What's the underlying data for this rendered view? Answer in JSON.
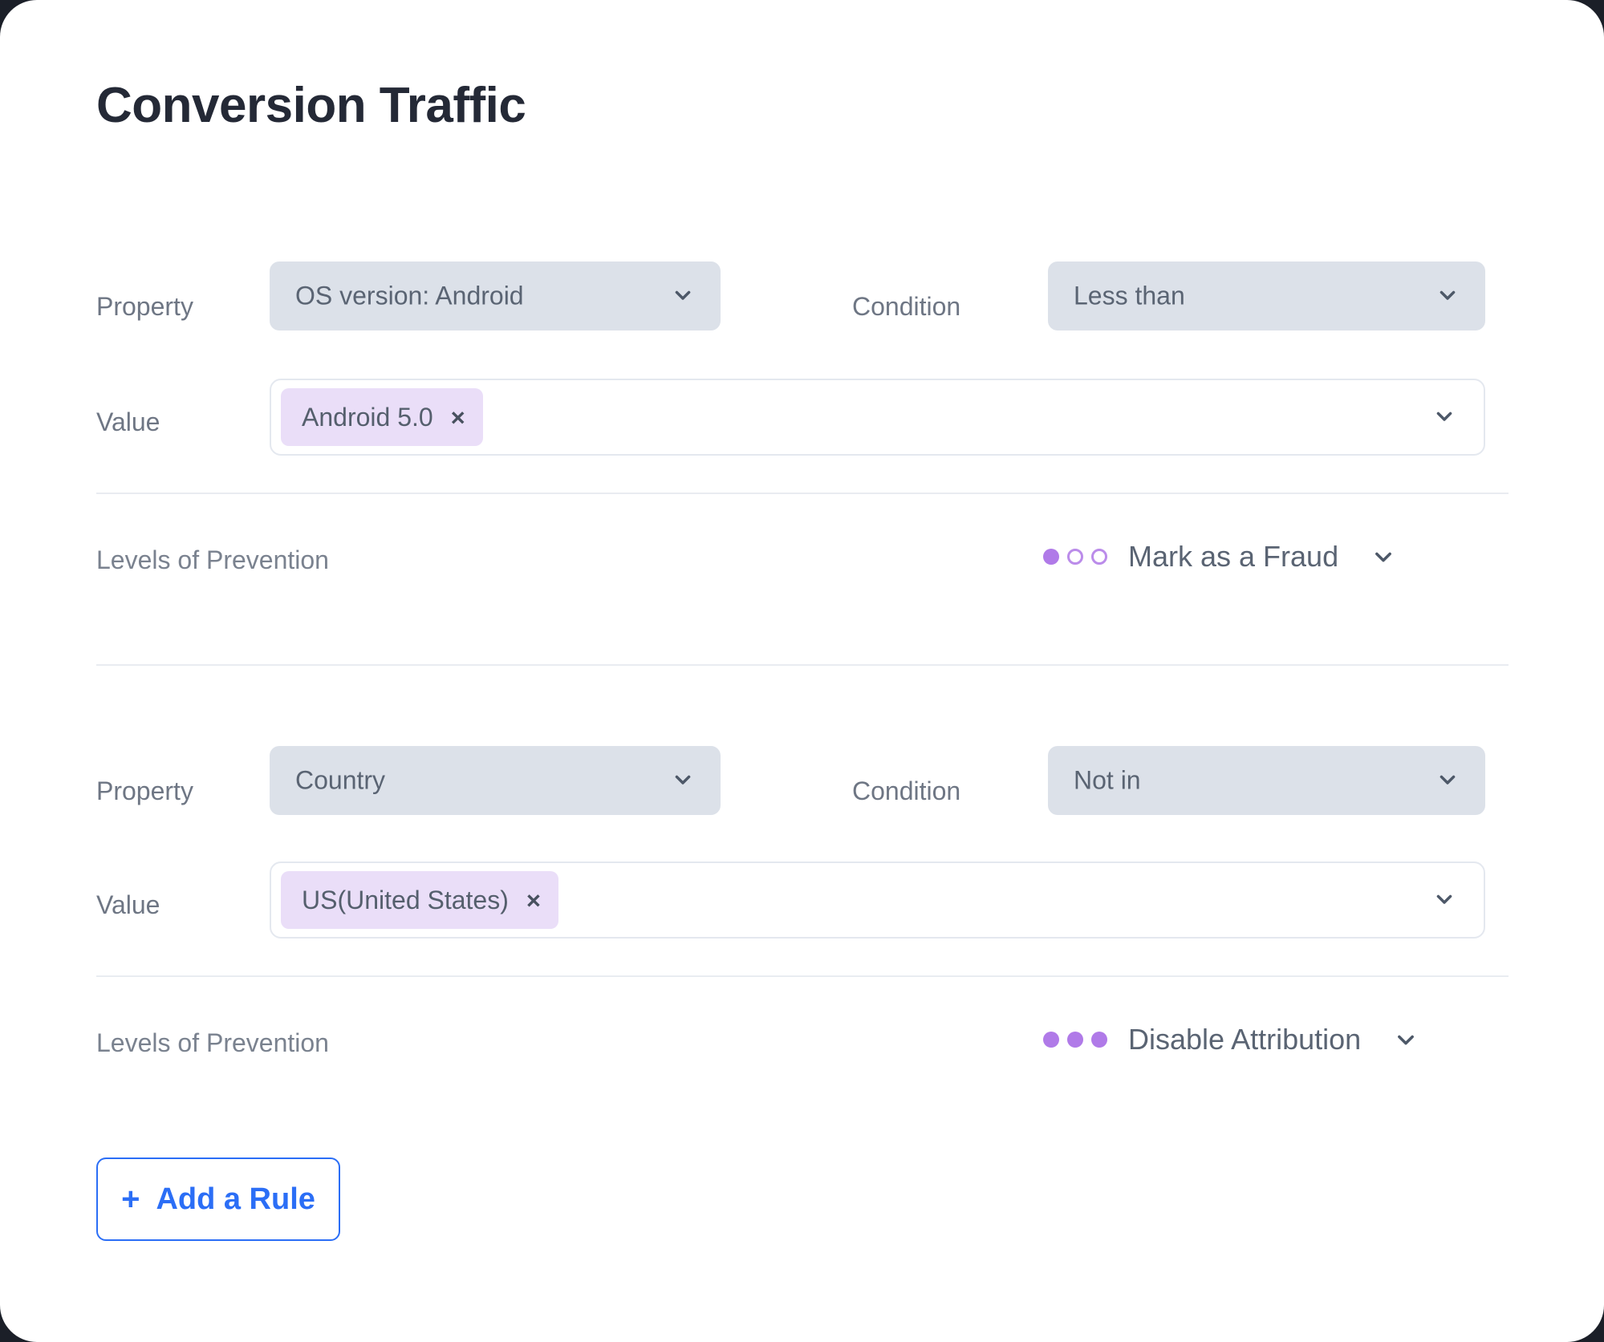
{
  "header": {
    "title": "Conversion Traffic"
  },
  "colors": {
    "accent_blue": "#2b6ef6",
    "chip_bg": "#eadef8",
    "select_bg": "#dce1e9",
    "dot_purple": "#b07ae8",
    "title_text": "#242936",
    "label_text": "#6e7684"
  },
  "labels": {
    "property": "Property",
    "condition": "Condition",
    "value": "Value",
    "levels_of_prevention": "Levels of Prevention"
  },
  "rules": [
    {
      "property": "OS version: Android",
      "condition": "Less than",
      "value_chip": "Android 5.0",
      "chip_remove": "×",
      "prevention_level": "Mark as a Fraud",
      "prevention_dots_filled": 1,
      "prevention_dots_total": 3
    },
    {
      "property": "Country",
      "condition": "Not in",
      "value_chip": "US(United States)",
      "chip_remove": "×",
      "prevention_level": "Disable Attribution",
      "prevention_dots_filled": 3,
      "prevention_dots_total": 3
    }
  ],
  "add_rule": {
    "plus": "+",
    "label": "Add a Rule"
  }
}
